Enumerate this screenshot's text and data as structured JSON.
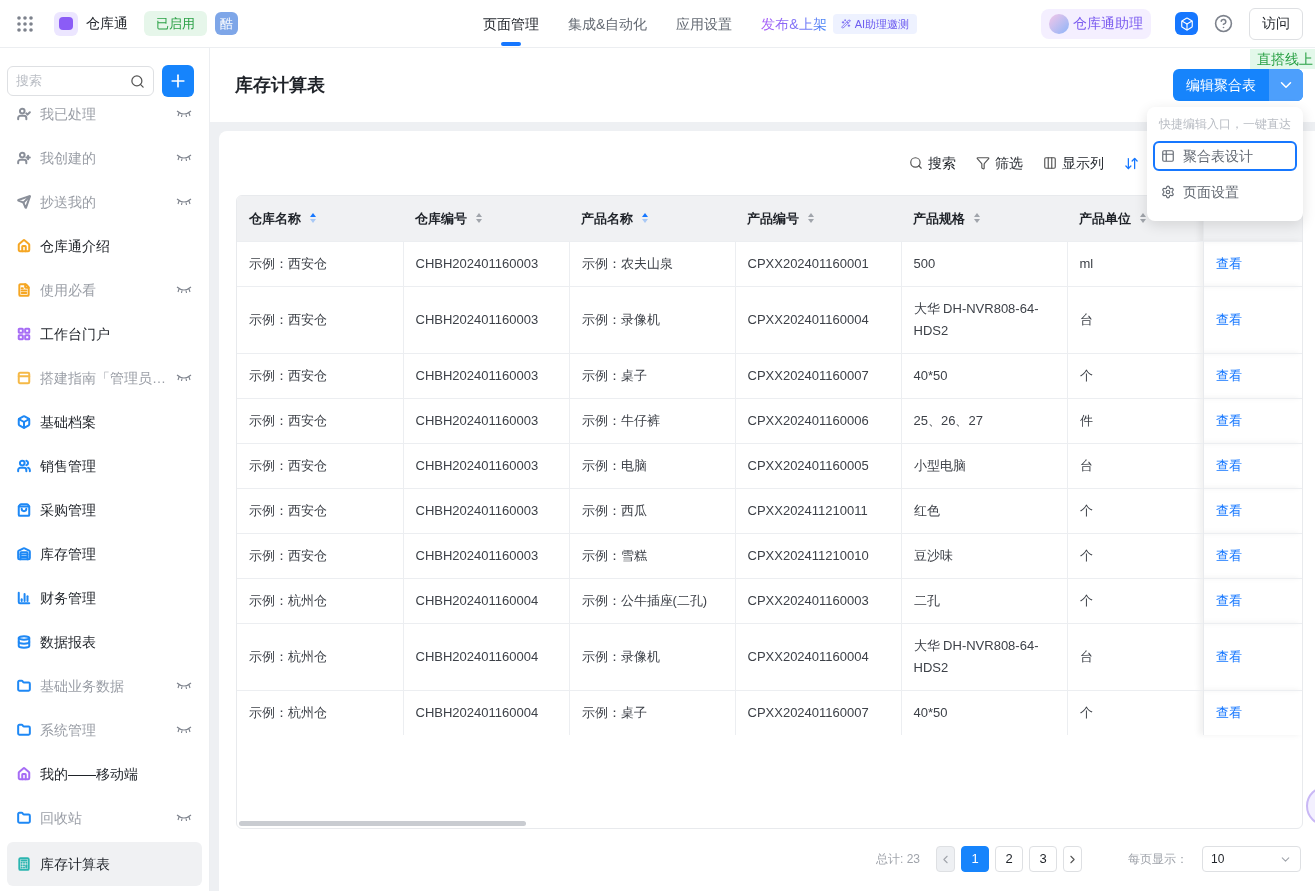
{
  "app": {
    "name": "仓库通",
    "status": "已启用",
    "badge": "酷"
  },
  "nav_tabs": [
    {
      "label": "页面管理",
      "selected": true,
      "kind": "plain"
    },
    {
      "label": "集成&自动化",
      "selected": false,
      "kind": "plain"
    },
    {
      "label": "应用设置",
      "selected": false,
      "kind": "plain"
    },
    {
      "label": "发布&上架",
      "selected": false,
      "kind": "gradient"
    }
  ],
  "ai_badge": "AI助理邀测",
  "assistant": "仓库通助理",
  "visit_button": "访问",
  "corner_tag": "直搭线上",
  "sidebar": {
    "search": {
      "placeholder": "搜索"
    },
    "items": [
      {
        "label": "我已处理",
        "hidden": true,
        "selected": false,
        "color": "#8a8f99"
      },
      {
        "label": "我创建的",
        "hidden": true,
        "selected": false,
        "color": "#8a8f99"
      },
      {
        "label": "抄送我的",
        "hidden": true,
        "selected": false,
        "color": "#8a8f99"
      },
      {
        "label": "仓库通介绍",
        "hidden": false,
        "selected": false,
        "color": "#f5a623"
      },
      {
        "label": "使用必看",
        "hidden": true,
        "selected": false,
        "color": "#f5a623"
      },
      {
        "label": "工作台门户",
        "hidden": false,
        "selected": false,
        "color": "#a66cf5"
      },
      {
        "label": "搭建指南「管理员…",
        "hidden": true,
        "selected": false,
        "color": "#f5b947"
      },
      {
        "label": "基础档案",
        "hidden": false,
        "selected": false,
        "color": "#1e88f5"
      },
      {
        "label": "销售管理",
        "hidden": false,
        "selected": false,
        "color": "#1e88f5"
      },
      {
        "label": "采购管理",
        "hidden": false,
        "selected": false,
        "color": "#1e88f5"
      },
      {
        "label": "库存管理",
        "hidden": false,
        "selected": false,
        "color": "#1e88f5"
      },
      {
        "label": "财务管理",
        "hidden": false,
        "selected": false,
        "color": "#1e88f5"
      },
      {
        "label": "数据报表",
        "hidden": false,
        "selected": false,
        "color": "#1e88f5"
      },
      {
        "label": "基础业务数据",
        "hidden": true,
        "selected": false,
        "color": "#1e88f5"
      },
      {
        "label": "系统管理",
        "hidden": true,
        "selected": false,
        "color": "#1e88f5"
      },
      {
        "label": "我的——移动端",
        "hidden": false,
        "selected": false,
        "color": "#a66cf5"
      },
      {
        "label": "回收站",
        "hidden": true,
        "selected": false,
        "color": "#1e88f5"
      },
      {
        "label": "库存计算表",
        "hidden": false,
        "selected": true,
        "color": "#2bb5b0"
      }
    ]
  },
  "page": {
    "title": "库存计算表",
    "edit_button": "编辑聚合表"
  },
  "toolbar": [
    "搜索",
    "筛选",
    "显示列"
  ],
  "dropdown": {
    "hint": "快捷编辑入口，一键直达",
    "items": [
      {
        "label": "聚合表设计",
        "selected": true
      },
      {
        "label": "页面设置",
        "selected": false
      }
    ]
  },
  "table": {
    "columns": [
      {
        "label": "仓库名称",
        "sorted": true
      },
      {
        "label": "仓库编号",
        "sorted": false
      },
      {
        "label": "产品名称",
        "sorted": true
      },
      {
        "label": "产品编号",
        "sorted": false
      },
      {
        "label": "产品规格",
        "sorted": false
      },
      {
        "label": "产品单位",
        "sorted": false
      }
    ],
    "rows": [
      {
        "cells": [
          "示例：西安仓",
          "CHBH202401160003",
          "示例：农夫山泉",
          "CPXX202401160001",
          "500",
          "ml"
        ],
        "action": "查看"
      },
      {
        "cells": [
          "示例：西安仓",
          "CHBH202401160003",
          "示例：录像机",
          "CPXX202401160004",
          "大华 DH-NVR808-64-HDS2",
          "台"
        ],
        "action": "查看"
      },
      {
        "cells": [
          "示例：西安仓",
          "CHBH202401160003",
          "示例：桌子",
          "CPXX202401160007",
          "40*50",
          "个"
        ],
        "action": "查看"
      },
      {
        "cells": [
          "示例：西安仓",
          "CHBH202401160003",
          "示例：牛仔裤",
          "CPXX202401160006",
          "25、26、27",
          "件"
        ],
        "action": "查看"
      },
      {
        "cells": [
          "示例：西安仓",
          "CHBH202401160003",
          "示例：电脑",
          "CPXX202401160005",
          "小型电脑",
          "台"
        ],
        "action": "查看"
      },
      {
        "cells": [
          "示例：西安仓",
          "CHBH202401160003",
          "示例：西瓜",
          "CPXX202411210011",
          "红色",
          "个"
        ],
        "action": "查看"
      },
      {
        "cells": [
          "示例：西安仓",
          "CHBH202401160003",
          "示例：雪糕",
          "CPXX202411210010",
          "豆沙味",
          "个"
        ],
        "action": "查看"
      },
      {
        "cells": [
          "示例：杭州仓",
          "CHBH202401160004",
          "示例：公牛插座(二孔)",
          "CPXX202401160003",
          "二孔",
          "个"
        ],
        "action": "查看"
      },
      {
        "cells": [
          "示例：杭州仓",
          "CHBH202401160004",
          "示例：录像机",
          "CPXX202401160004",
          "大华 DH-NVR808-64-HDS2",
          "台"
        ],
        "action": "查看"
      },
      {
        "cells": [
          "示例：杭州仓",
          "CHBH202401160004",
          "示例：桌子",
          "CPXX202401160007",
          "40*50",
          "个"
        ],
        "action": "查看"
      }
    ]
  },
  "pagination": {
    "total": "总计: 23",
    "pages": [
      {
        "label": "1",
        "selected": true
      },
      {
        "label": "2",
        "selected": false
      },
      {
        "label": "3",
        "selected": false
      }
    ],
    "per_page_label": "每页显示：",
    "per_page": "10"
  }
}
